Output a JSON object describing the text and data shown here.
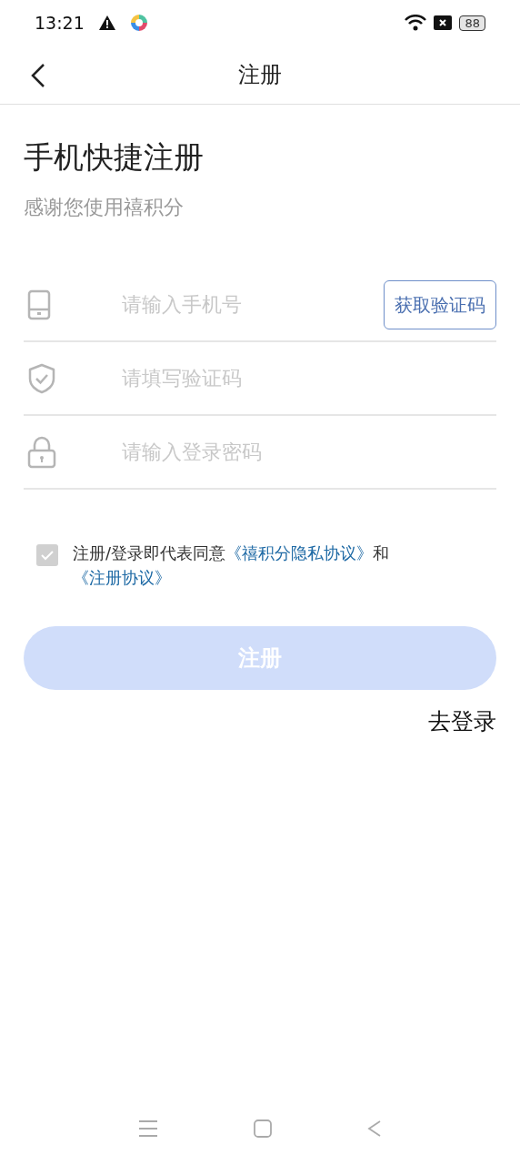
{
  "status_bar": {
    "time": "13:21",
    "battery": "88"
  },
  "nav": {
    "title": "注册"
  },
  "heading": "手机快捷注册",
  "subtitle": "感谢您使用禧积分",
  "fields": [
    {
      "kind": "phone",
      "placeholder": "请输入手机号",
      "button": "获取验证码"
    },
    {
      "kind": "code",
      "placeholder": "请填写验证码"
    },
    {
      "kind": "password",
      "placeholder": "请输入登录密码"
    }
  ],
  "agreement": {
    "checked": true,
    "parts": [
      {
        "kind": "text",
        "text": "注册/登录即代表同意"
      },
      {
        "kind": "link",
        "text": "《禧积分隐私协议》"
      },
      {
        "kind": "text",
        "text": "和"
      },
      {
        "kind": "link",
        "text": "《注册协议》"
      }
    ]
  },
  "submit": {
    "label": "注册",
    "disabled": true
  },
  "login_link": "去登录"
}
